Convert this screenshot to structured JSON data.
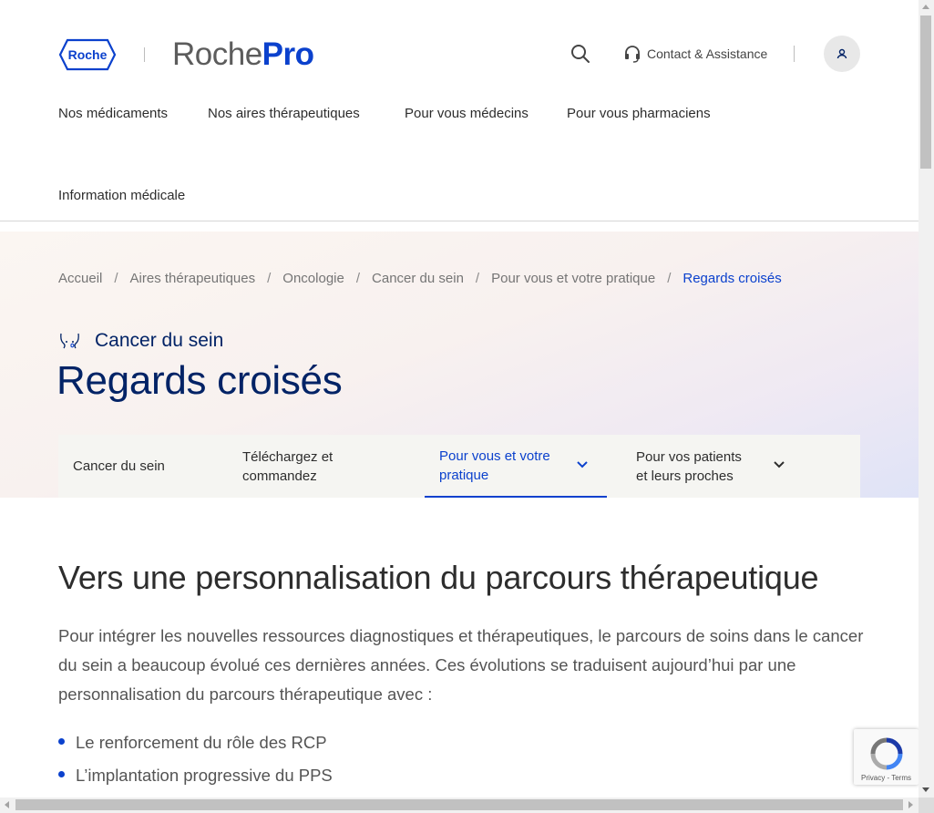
{
  "header": {
    "logo_text": "Roche",
    "brand_part1": "Roche",
    "brand_part2": "Pro",
    "contact_label": "Contact & Assistance",
    "nav": [
      "Nos médicaments",
      "Nos aires thérapeutiques",
      "Pour vous médecins",
      "Pour vous pharmaciens",
      "Information médicale"
    ]
  },
  "breadcrumb": [
    "Accueil",
    "Aires thérapeutiques",
    "Oncologie",
    "Cancer du sein",
    "Pour vous et votre pratique",
    "Regards croisés"
  ],
  "hero": {
    "category": "Cancer du sein",
    "title": "Regards croisés"
  },
  "tabs": [
    {
      "line1": "Cancer du sein",
      "line2": ""
    },
    {
      "line1": "Téléchargez et",
      "line2": "commandez"
    },
    {
      "line1": "Pour vous et votre",
      "line2": "pratique"
    },
    {
      "line1": "Pour vos patients",
      "line2": "et leurs proches"
    }
  ],
  "content": {
    "heading": "Vers une personnalisation du parcours thérapeutique",
    "paragraph": "Pour intégrer les nouvelles ressources diagnostiques et thérapeutiques, le parcours de soins dans le cancer du sein a beaucoup évolué ces dernières années. Ces évolutions se traduisent aujourd’hui par une personnalisation du parcours thérapeutique avec :",
    "bullets": [
      "Le renforcement du rôle des RCP",
      "L’implantation progressive du PPS"
    ]
  },
  "recaptcha": {
    "links": "Privacy - Terms"
  },
  "colors": {
    "accent": "#0b41cd",
    "navy": "#022366"
  }
}
